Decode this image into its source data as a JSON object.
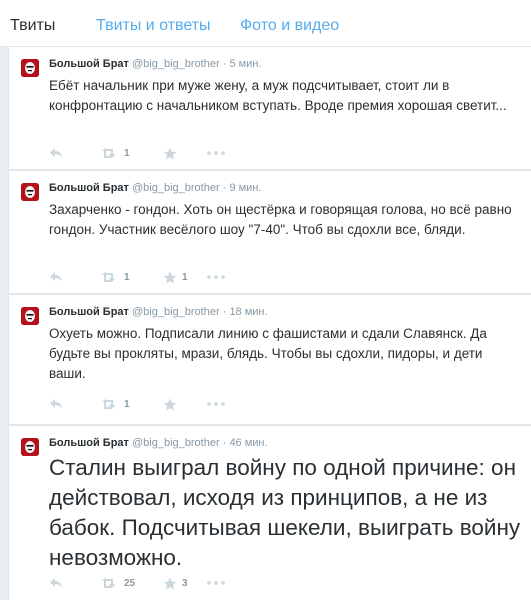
{
  "tabs": [
    {
      "label": "Твиты",
      "active": true
    },
    {
      "label": "Твиты и ответы",
      "active": false
    },
    {
      "label": "Фото и видео",
      "active": false
    }
  ],
  "tweets": [
    {
      "fullname": "Большой Брат",
      "handle": "@big_big_brother",
      "dot": "·",
      "time": "5 мин.",
      "text": "Ебёт начальник при муже жену, а муж подсчитывает, стоит ли в конфронтацию с начальником вступать. Вроде премия хорошая светит...",
      "retweets": "1",
      "favorites": ""
    },
    {
      "fullname": "Большой Брат",
      "handle": "@big_big_brother",
      "dot": "·",
      "time": "9 мин.",
      "text": "Захарченко - гондон. Хоть он щестёрка и говорящая голова, но всё равно гондон. Участник весёлого шоу \"7-40\". Чтоб вы сдохли все, бляди.",
      "retweets": "1",
      "favorites": "1"
    },
    {
      "fullname": "Большой Брат",
      "handle": "@big_big_brother",
      "dot": "·",
      "time": "18 мин.",
      "text": "Охуеть можно. Подписали линию с фашистами и сдали Славянск. Да будьте вы прокляты, мрази, блядь. Чтобы вы сдохли, пидоры, и дети ваши.",
      "retweets": "1",
      "favorites": ""
    },
    {
      "fullname": "Большой Брат",
      "handle": "@big_big_brother",
      "dot": "·",
      "time": "46 мин.",
      "text": "Сталин выиграл войну по одной причине: он действовал, исходя из принципов, а не из бабок. Подсчитывая шекели, выиграть войну невозможно.",
      "retweets": "25",
      "favorites": "3"
    }
  ],
  "colors": {
    "link": "#55acee",
    "muted": "#8899a6",
    "icon": "#ccd6dd",
    "avatar": "#b3121b"
  }
}
